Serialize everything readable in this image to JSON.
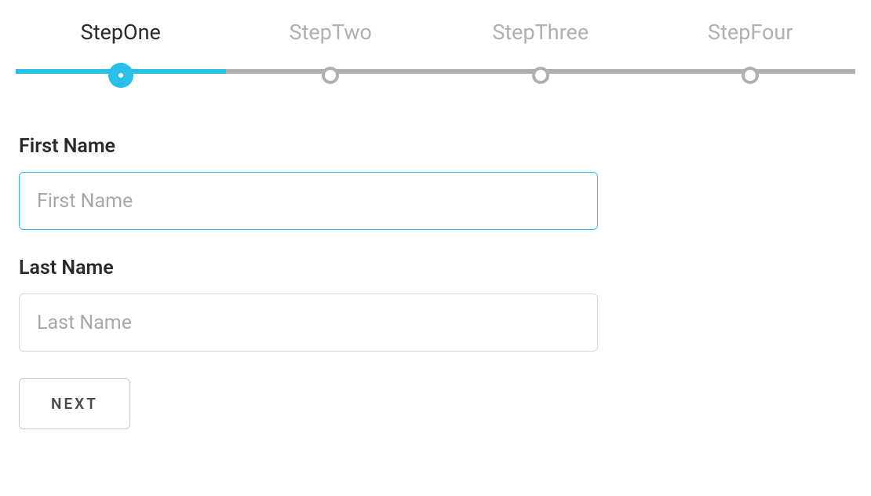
{
  "stepper": {
    "steps": [
      {
        "label": "StepOne",
        "active": true
      },
      {
        "label": "StepTwo",
        "active": false
      },
      {
        "label": "StepThree",
        "active": false
      },
      {
        "label": "StepFour",
        "active": false
      }
    ]
  },
  "form": {
    "first_name": {
      "label": "First Name",
      "placeholder": "First Name",
      "value": ""
    },
    "last_name": {
      "label": "Last Name",
      "placeholder": "Last Name",
      "value": ""
    },
    "next_button": "NEXT"
  }
}
